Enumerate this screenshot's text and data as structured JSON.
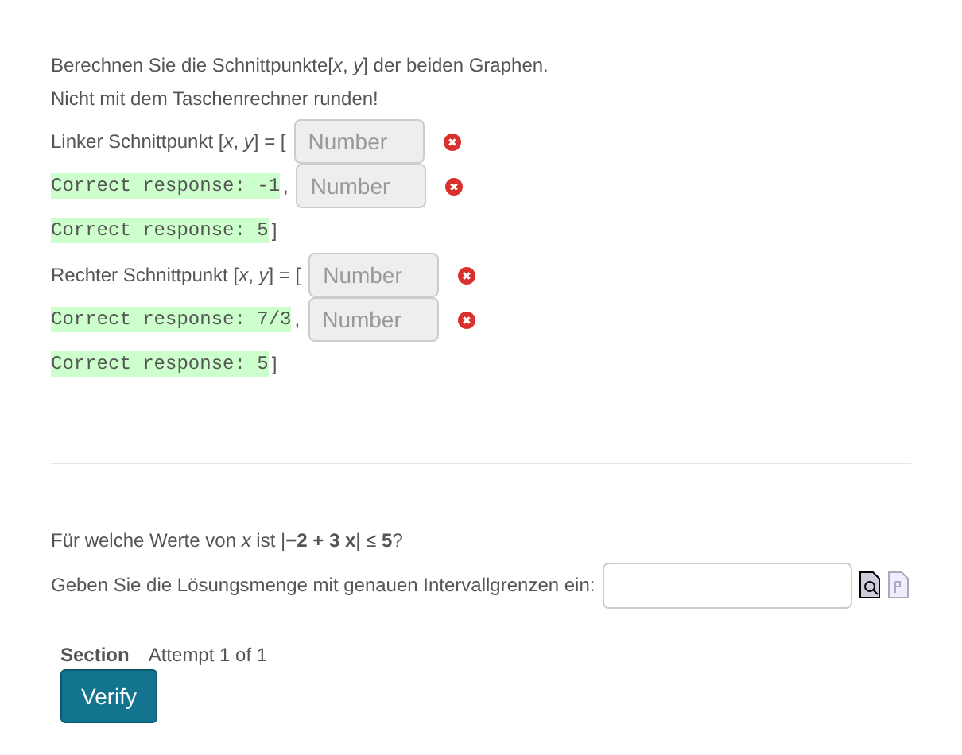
{
  "question1": {
    "intro": [
      "Berechnen Sie die Schnittpunkte[*x*, *y*] der beiden Graphen.",
      "Nicht mit dem Taschenrechner runden!"
    ],
    "lines": [
      {
        "items": [
          {
            "kind": "text",
            "text": "Linker Schnittpunkt [*x*, *y*] =  ["
          },
          {
            "kind": "field",
            "placeholder": "Number",
            "incorrect": true
          }
        ]
      },
      {
        "items": [
          {
            "kind": "correct",
            "text": "Correct response: -1"
          },
          {
            "kind": "text",
            "text": ","
          },
          {
            "kind": "field",
            "placeholder": "Number",
            "incorrect": true
          }
        ]
      },
      {
        "items": [
          {
            "kind": "correct",
            "text": "Correct response: 5"
          },
          {
            "kind": "text",
            "text": "]"
          }
        ]
      },
      {
        "items": [
          {
            "kind": "text",
            "text": "Rechter Schnittpunkt [*x*, *y*] = ["
          },
          {
            "kind": "field",
            "placeholder": "Number",
            "incorrect": true
          }
        ]
      },
      {
        "items": [
          {
            "kind": "correct",
            "text": "Correct response: 7/3"
          },
          {
            "kind": "text",
            "text": ","
          },
          {
            "kind": "field",
            "placeholder": "Number",
            "incorrect": true
          }
        ]
      },
      {
        "items": [
          {
            "kind": "correct",
            "text": "Correct response: 5"
          },
          {
            "kind": "text",
            "text": "]"
          }
        ]
      }
    ]
  },
  "question2": {
    "question": "Für welche Werte von *x* ist |**−2 + 3 x**| ≤ **5**?",
    "prompt": "Geben Sie die Lösungsmenge mit genauen Intervallgrenzen ein:"
  },
  "section": {
    "label": "Section",
    "attempt": "Attempt 1 of 1",
    "button": "Verify"
  }
}
